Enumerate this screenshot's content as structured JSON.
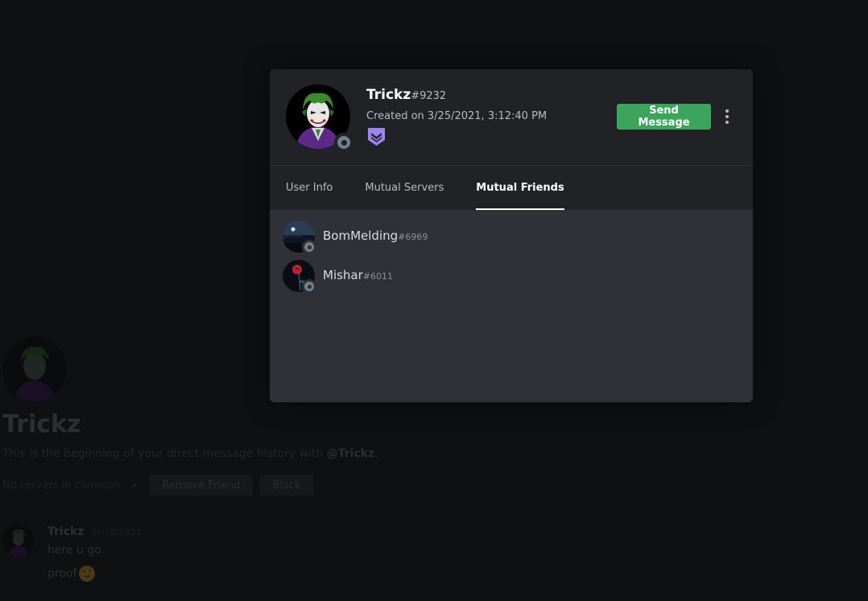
{
  "background": {
    "title": "Trickz",
    "description_prefix": "This is the beginning of your direct message history with ",
    "description_mention": "@Trickz",
    "description_suffix": ".",
    "no_servers": "No servers in common",
    "remove_friend_label": "Remove Friend",
    "block_label": "Block",
    "message": {
      "author": "Trickz",
      "timestamp": "05/18/2021",
      "lines": [
        "here u go",
        "proof"
      ]
    }
  },
  "profile": {
    "username": "Trickz",
    "discriminator": "#9232",
    "created": "Created on 3/25/2021, 3:12:40 PM",
    "badge_icon": "hypesquad-badge-icon",
    "status_color": "#747f8d",
    "send_message_label": "Send Message",
    "tabs": [
      {
        "label": "User Info",
        "active": false
      },
      {
        "label": "Mutual Servers",
        "active": false
      },
      {
        "label": "Mutual Friends",
        "active": true
      }
    ],
    "mutual_friends": [
      {
        "name": "BomMelding",
        "discriminator": "#6969"
      },
      {
        "name": "Mishar",
        "discriminator": "#6011"
      }
    ]
  },
  "colors": {
    "send_button": "#3ba55c",
    "badge": "#9b84ec",
    "joker_hair": "#3b8a2a",
    "joker_suit": "#5b2a86"
  }
}
